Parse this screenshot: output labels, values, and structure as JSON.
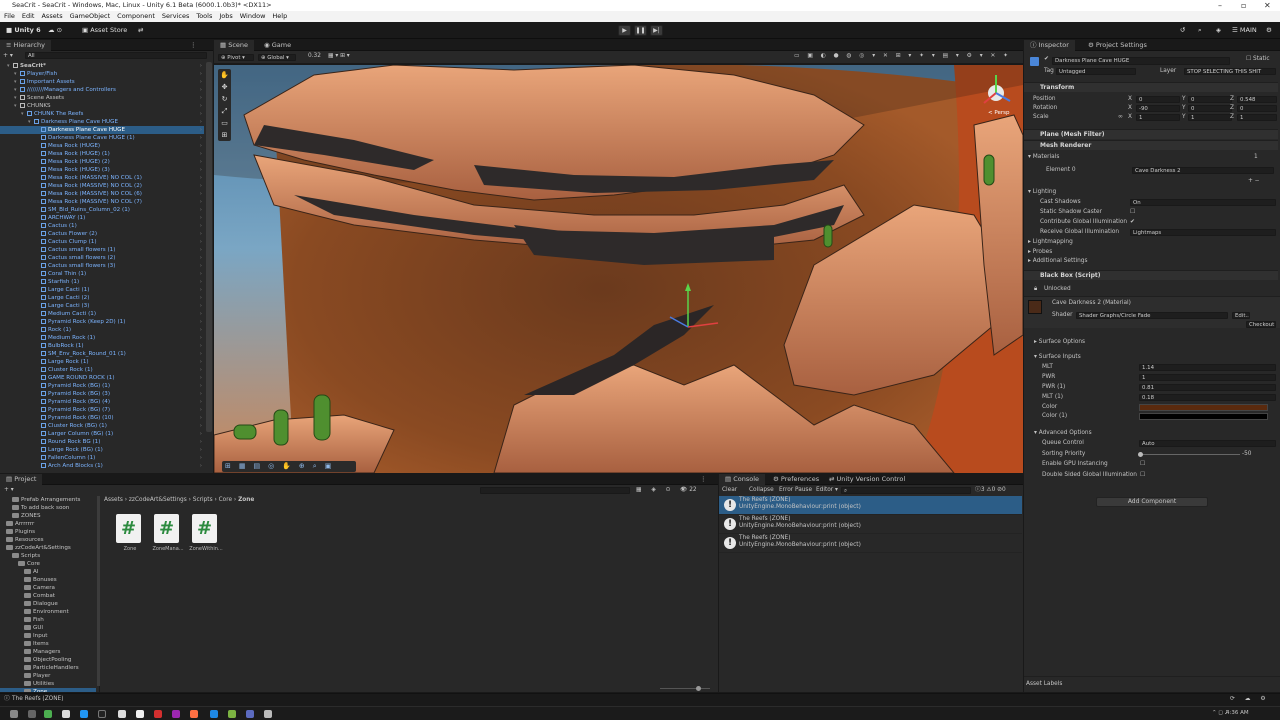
{
  "window": {
    "title": "SeaCrit - SeaCrit - Windows, Mac, Linux - Unity 6.1 Beta (6000.1.0b3)* <DX11>"
  },
  "menu": [
    "File",
    "Edit",
    "Assets",
    "GameObject",
    "Component",
    "Services",
    "Tools",
    "Jobs",
    "Window",
    "Help"
  ],
  "toolbar": {
    "account": "Unity 6",
    "asset_store": "Asset Store",
    "layout": "MAIN"
  },
  "hierarchy": {
    "tab": "Hierarchy",
    "search_placeholder": "All",
    "rows": [
      {
        "label": "SeaCrit*",
        "indent": 1,
        "kind": "root"
      },
      {
        "label": "Player/Fish",
        "indent": 2,
        "kind": "blue"
      },
      {
        "label": "Important Assets",
        "indent": 2,
        "kind": "blue"
      },
      {
        "label": "/////////Managers and Controllers",
        "indent": 2,
        "kind": "blue"
      },
      {
        "label": "Scene Assets",
        "indent": 2,
        "kind": "plain"
      },
      {
        "label": "CHUNKS",
        "indent": 2,
        "kind": "plain"
      },
      {
        "label": "CHUNK The Reefs",
        "indent": 3,
        "kind": "blue"
      },
      {
        "label": "Darkness Plane Cave HUGE",
        "indent": 4,
        "kind": "blue"
      },
      {
        "label": "Darkness Plane Cave HUGE",
        "indent": 5,
        "kind": "selected"
      },
      {
        "label": "Darkness Plane Cave HUGE (1)",
        "indent": 5,
        "kind": "blue"
      },
      {
        "label": "Mesa Rock (HUGE)",
        "indent": 5,
        "kind": "blue"
      },
      {
        "label": "Mesa Rock (HUGE) (1)",
        "indent": 5,
        "kind": "blue"
      },
      {
        "label": "Mesa Rock (HUGE) (2)",
        "indent": 5,
        "kind": "blue"
      },
      {
        "label": "Mesa Rock (HUGE) (3)",
        "indent": 5,
        "kind": "blue"
      },
      {
        "label": "Mesa Rock (MASSIVE) NO COL (1)",
        "indent": 5,
        "kind": "blue"
      },
      {
        "label": "Mesa Rock (MASSIVE) NO COL (2)",
        "indent": 5,
        "kind": "blue"
      },
      {
        "label": "Mesa Rock (MASSIVE) NO COL (6)",
        "indent": 5,
        "kind": "blue"
      },
      {
        "label": "Mesa Rock (MASSIVE) NO COL (7)",
        "indent": 5,
        "kind": "blue"
      },
      {
        "label": "SM_Bld_Ruins_Column_02 (1)",
        "indent": 5,
        "kind": "blue"
      },
      {
        "label": "ARCHWAY (1)",
        "indent": 5,
        "kind": "blue"
      },
      {
        "label": "Cactus (1)",
        "indent": 5,
        "kind": "blue"
      },
      {
        "label": "Cactus Flower (2)",
        "indent": 5,
        "kind": "blue"
      },
      {
        "label": "Cactus Clump (1)",
        "indent": 5,
        "kind": "blue"
      },
      {
        "label": "Cactus small flowers (1)",
        "indent": 5,
        "kind": "blue"
      },
      {
        "label": "Cactus small flowers (2)",
        "indent": 5,
        "kind": "blue"
      },
      {
        "label": "Cactus small flowers (3)",
        "indent": 5,
        "kind": "blue"
      },
      {
        "label": "Coral Thin (1)",
        "indent": 5,
        "kind": "blue"
      },
      {
        "label": "Starfish (1)",
        "indent": 5,
        "kind": "blue"
      },
      {
        "label": "Large Cacti (1)",
        "indent": 5,
        "kind": "blue"
      },
      {
        "label": "Large Cacti (2)",
        "indent": 5,
        "kind": "blue"
      },
      {
        "label": "Large Cacti (3)",
        "indent": 5,
        "kind": "blue"
      },
      {
        "label": "Medium Cacti (1)",
        "indent": 5,
        "kind": "blue"
      },
      {
        "label": "Pyramid Rock (Keep 2D) (1)",
        "indent": 5,
        "kind": "blue"
      },
      {
        "label": "Rock (1)",
        "indent": 5,
        "kind": "blue"
      },
      {
        "label": "Medium Rock (1)",
        "indent": 5,
        "kind": "blue"
      },
      {
        "label": "BulbRock (1)",
        "indent": 5,
        "kind": "blue"
      },
      {
        "label": "SM_Env_Rock_Round_01 (1)",
        "indent": 5,
        "kind": "blue"
      },
      {
        "label": "Large Rock (1)",
        "indent": 5,
        "kind": "blue"
      },
      {
        "label": "Cluster Rock (1)",
        "indent": 5,
        "kind": "blue"
      },
      {
        "label": "GAME ROUND ROCK (1)",
        "indent": 5,
        "kind": "blue"
      },
      {
        "label": "Pyramid Rock (BG) (1)",
        "indent": 5,
        "kind": "blue"
      },
      {
        "label": "Pyramid Rock (BG) (3)",
        "indent": 5,
        "kind": "blue"
      },
      {
        "label": "Pyramid Rock (BG) (4)",
        "indent": 5,
        "kind": "blue"
      },
      {
        "label": "Pyramid Rock (BG) (7)",
        "indent": 5,
        "kind": "blue"
      },
      {
        "label": "Pyramid Rock (BG) (10)",
        "indent": 5,
        "kind": "blue"
      },
      {
        "label": "Cluster Rock (BG) (1)",
        "indent": 5,
        "kind": "blue"
      },
      {
        "label": "Larger Column (BG) (1)",
        "indent": 5,
        "kind": "blue"
      },
      {
        "label": "Round Rock BG (1)",
        "indent": 5,
        "kind": "blue"
      },
      {
        "label": "Large Rock (BG) (1)",
        "indent": 5,
        "kind": "blue"
      },
      {
        "label": "FallenColumn (1)",
        "indent": 5,
        "kind": "blue"
      },
      {
        "label": "Arch And Blocks (1)",
        "indent": 5,
        "kind": "blue"
      }
    ]
  },
  "scene": {
    "tabs": [
      "Scene",
      "Game"
    ],
    "pivot": "Pivot",
    "space": "Global",
    "snap_value": "0.32",
    "persp_label": "< Persp"
  },
  "inspector": {
    "tabs": [
      "Inspector",
      "Project Settings"
    ],
    "object_name": "Darkness Plane Cave HUGE",
    "static_label": "Static",
    "tag_label": "Tag",
    "tag_value": "Untagged",
    "layer_label": "Layer",
    "layer_value": "STOP SELECTING THIS SHIT",
    "transform": {
      "title": "Transform",
      "position": {
        "label": "Position",
        "x": "0",
        "y": "0",
        "z": "0.548"
      },
      "rotation": {
        "label": "Rotation",
        "x": "-90",
        "y": "0",
        "z": "0"
      },
      "scale": {
        "label": "Scale",
        "x": "1",
        "y": "1",
        "z": "1"
      }
    },
    "mesh_filter": "Plane (Mesh Filter)",
    "mesh_renderer": "Mesh Renderer",
    "materials": {
      "label": "Materials",
      "count": "1",
      "element_label": "Element 0",
      "element_value": "Cave Darkness 2"
    },
    "lighting": {
      "label": "Lighting",
      "cast_shadows": {
        "label": "Cast Shadows",
        "value": "On"
      },
      "static_shadow_caster": "Static Shadow Caster",
      "contribute_gi": "Contribute Global Illumination",
      "receive_gi": {
        "label": "Receive Global Illumination",
        "value": "Lightmaps"
      }
    },
    "lightmapping": "Lightmapping",
    "probes": "Probes",
    "additional_settings": "Additional Settings",
    "black_box": {
      "title": "Black Box (Script)",
      "state": "Unlocked"
    },
    "material": {
      "name": "Cave Darkness 2 (Material)",
      "shader_label": "Shader",
      "shader_value": "Shader Graphs/Circle Fade",
      "edit_label": "Edit...",
      "checkout_label": "Checkout"
    },
    "surface_options": "Surface Options",
    "surface_inputs": {
      "label": "Surface Inputs",
      "rows": [
        {
          "label": "MLT",
          "value": "1.14"
        },
        {
          "label": "PWR",
          "value": "1"
        },
        {
          "label": "PWR (1)",
          "value": "0.81"
        },
        {
          "label": "MLT (1)",
          "value": "0.18"
        }
      ],
      "color_label": "Color",
      "color1_label": "Color (1)",
      "color_swatch": "#5a2a0e",
      "color1_swatch": "#000000"
    },
    "advanced": {
      "label": "Advanced Options",
      "queue_control": {
        "label": "Queue Control",
        "value": "Auto"
      },
      "sorting_priority": {
        "label": "Sorting Priority",
        "value": "-50"
      },
      "gpu_instancing": "Enable GPU Instancing",
      "double_sided_gi": "Double Sided Global Illumination"
    },
    "add_component": "Add Component",
    "asset_labels": "Asset Labels"
  },
  "project": {
    "tab": "Project",
    "breadcrumb": [
      "Assets",
      "zzCodeArt&Settings",
      "Scripts",
      "Core",
      "Zone"
    ],
    "tree": [
      {
        "label": "Prefab Arrangements",
        "indent": 2
      },
      {
        "label": "To add back soon",
        "indent": 2
      },
      {
        "label": "ZONES",
        "indent": 2
      },
      {
        "label": "Arrrrrrr",
        "indent": 1
      },
      {
        "label": "Plugins",
        "indent": 1
      },
      {
        "label": "Resources",
        "indent": 1
      },
      {
        "label": "zzCodeArt&Settings",
        "indent": 1
      },
      {
        "label": "Scripts",
        "indent": 2
      },
      {
        "label": "Core",
        "indent": 3
      },
      {
        "label": "AI",
        "indent": 4
      },
      {
        "label": "Bonuses",
        "indent": 4
      },
      {
        "label": "Camera",
        "indent": 4
      },
      {
        "label": "Combat",
        "indent": 4
      },
      {
        "label": "Dialogue",
        "indent": 4
      },
      {
        "label": "Environment",
        "indent": 4
      },
      {
        "label": "Fish",
        "indent": 4
      },
      {
        "label": "GUI",
        "indent": 4
      },
      {
        "label": "Input",
        "indent": 4
      },
      {
        "label": "Items",
        "indent": 4
      },
      {
        "label": "Managers",
        "indent": 4
      },
      {
        "label": "ObjectPooling",
        "indent": 4
      },
      {
        "label": "ParticleHandlers",
        "indent": 4
      },
      {
        "label": "Player",
        "indent": 4
      },
      {
        "label": "Utilities",
        "indent": 4
      },
      {
        "label": "Zone",
        "indent": 4
      }
    ],
    "files": [
      "Zone",
      "ZoneMana...",
      "ZoneWithin..."
    ],
    "count": "22"
  },
  "console": {
    "tabs": [
      "Console",
      "Preferences",
      "Unity Version Control"
    ],
    "buttons": [
      "Clear",
      "Collapse",
      "Error Pause",
      "Editor"
    ],
    "counts": {
      "errors": "3",
      "warnings": "0",
      "messages": "0"
    },
    "entries": [
      {
        "title": "The Reefs (ZONE)",
        "detail": "UnityEngine.MonoBehaviour:print (object)"
      },
      {
        "title": "The Reefs (ZONE)",
        "detail": "UnityEngine.MonoBehaviour:print (object)"
      },
      {
        "title": "The Reefs (ZONE)",
        "detail": "UnityEngine.MonoBehaviour:print (object)"
      }
    ]
  },
  "status_bar": {
    "message": "The Reefs (ZONE)"
  },
  "taskbar": {
    "time": "4:36 AM"
  }
}
